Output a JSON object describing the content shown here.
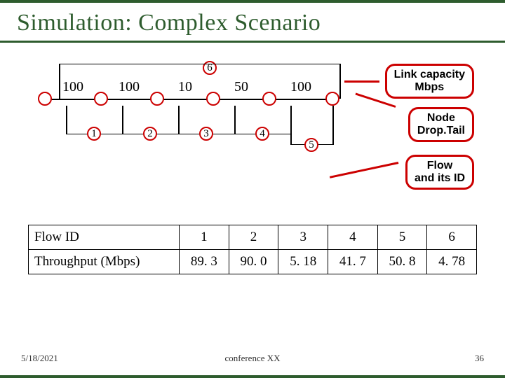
{
  "title": "Simulation: Complex Scenario",
  "links": {
    "caps": [
      "100",
      "100",
      "10",
      "50",
      "100"
    ],
    "flows_upper": [
      "6"
    ],
    "flows_lower": [
      "1",
      "2",
      "3",
      "4",
      "5"
    ]
  },
  "callouts": {
    "linkcap": "Link capacity\nMbps",
    "node": "Node\nDrop.Tail",
    "flow": "Flow\nand its ID"
  },
  "table": {
    "headers": [
      "Flow ID",
      "1",
      "2",
      "3",
      "4",
      "5",
      "6"
    ],
    "row_label": "Throughput (Mbps)",
    "values": [
      "89. 3",
      "90. 0",
      "5. 18",
      "41. 7",
      "50. 8",
      "4. 78"
    ]
  },
  "footer": {
    "date": "5/18/2021",
    "conf": "conference XX",
    "page": "36"
  }
}
